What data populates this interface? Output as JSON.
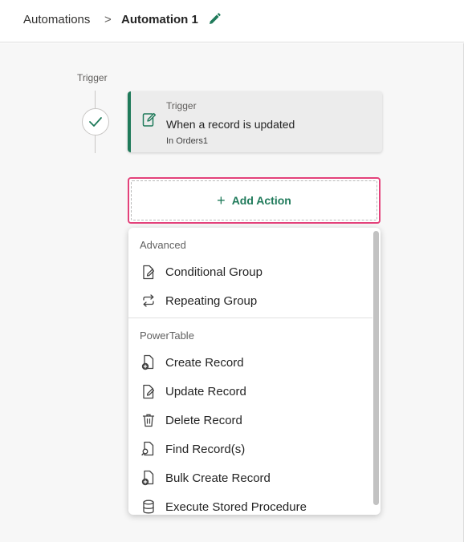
{
  "breadcrumb": {
    "root": "Automations",
    "separator": ">",
    "current": "Automation 1"
  },
  "timeline": {
    "trigger_label": "Trigger"
  },
  "trigger_card": {
    "kicker": "Trigger",
    "title": "When a record is updated",
    "subtitle": "In Orders1"
  },
  "add_action": {
    "icon": "+",
    "label": "Add Action"
  },
  "menu": {
    "groups": [
      {
        "title": "Advanced",
        "items": [
          {
            "label": "Conditional Group",
            "icon": "conditional-group-icon"
          },
          {
            "label": "Repeating Group",
            "icon": "repeat-icon"
          }
        ]
      },
      {
        "title": "PowerTable",
        "items": [
          {
            "label": "Create Record",
            "icon": "create-record-icon"
          },
          {
            "label": "Update Record",
            "icon": "update-record-icon"
          },
          {
            "label": "Delete Record",
            "icon": "trash-icon"
          },
          {
            "label": "Find Record(s)",
            "icon": "find-record-icon"
          },
          {
            "label": "Bulk Create Record",
            "icon": "bulk-create-icon"
          },
          {
            "label": "Execute Stored Procedure",
            "icon": "database-icon"
          }
        ]
      }
    ]
  },
  "colors": {
    "accent_green": "#1f7a5a",
    "highlight_pink": "#e3417a"
  }
}
